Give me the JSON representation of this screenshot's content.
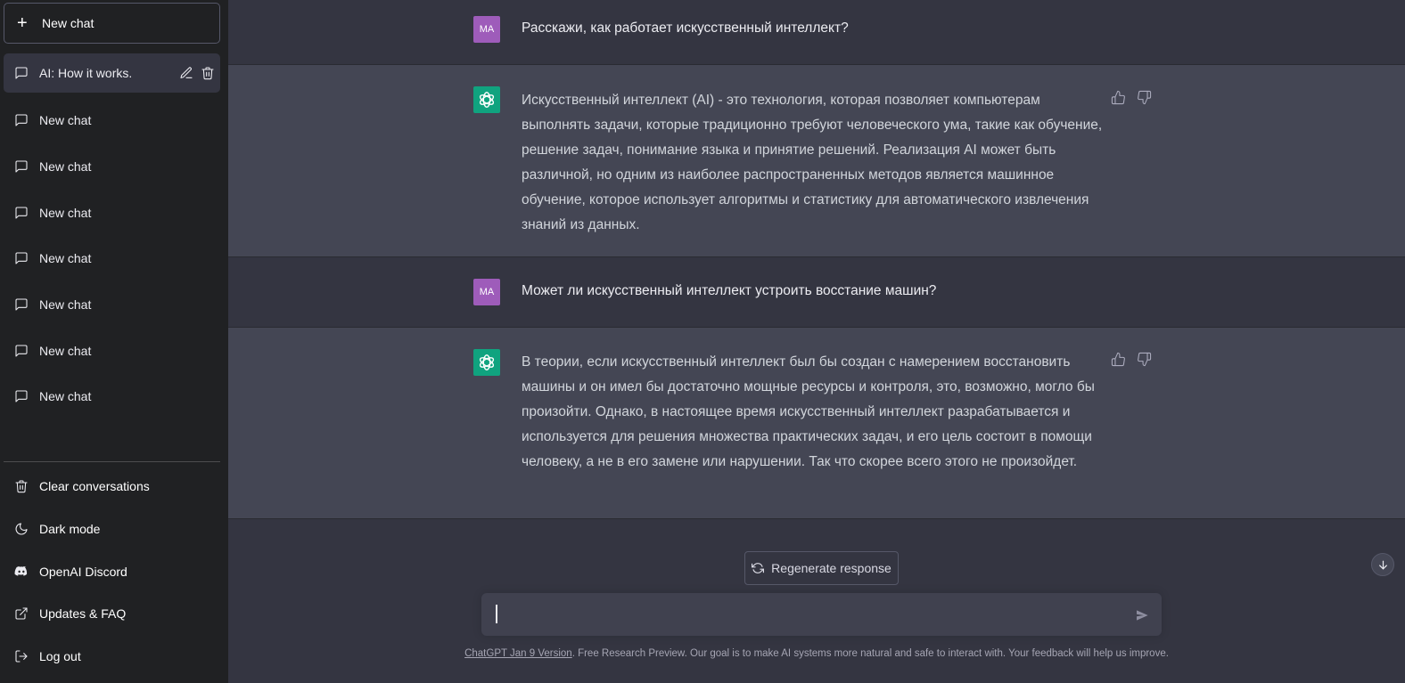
{
  "sidebar": {
    "new_chat_label": "New chat",
    "conversations": [
      {
        "label": "AI: How it works.",
        "active": true
      },
      {
        "label": "New chat"
      },
      {
        "label": "New chat"
      },
      {
        "label": "New chat"
      },
      {
        "label": "New chat"
      },
      {
        "label": "New chat"
      },
      {
        "label": "New chat"
      },
      {
        "label": "New chat"
      }
    ],
    "menu": {
      "clear": "Clear conversations",
      "dark_mode": "Dark mode",
      "discord": "OpenAI Discord",
      "updates": "Updates & FAQ",
      "logout": "Log out"
    }
  },
  "messages": [
    {
      "role": "user",
      "avatar": "MA",
      "text": "Расскажи, как работает искусственный интеллект?"
    },
    {
      "role": "assistant",
      "text": "Искусственный интеллект (AI) - это технология, которая позволяет компьютерам выполнять задачи, которые традиционно требуют человеческого ума, такие как обучение, решение задач, понимание языка и принятие решений. Реализация AI может быть различной, но одним из наиболее распространенных методов является машинное обучение, которое использует алгоритмы и статистику для автоматического извлечения знаний из данных."
    },
    {
      "role": "user",
      "avatar": "MA",
      "text": "Может ли искусственный интеллект устроить восстание машин?"
    },
    {
      "role": "assistant",
      "text": "В теории, если искусственный интеллект был бы создан с намерением восстановить машины и он имел бы достаточно мощные ресурсы и контроля, это, возможно, могло бы произойти. Однако, в настоящее время искусственный интеллект разрабатывается и используется для решения множества практических задач, и его цель состоит в помощи человеку, а не в его замене или нарушении. Так что скорее всего этого не произойдет."
    }
  ],
  "regenerate_label": "Regenerate response",
  "input": {
    "value": ""
  },
  "footer": {
    "version_link": "ChatGPT Jan 9 Version",
    "text": ". Free Research Preview. Our goal is to make AI systems more natural and safe to interact with. Your feedback will help us improve."
  },
  "colors": {
    "sidebar": "#202123",
    "main": "#343541",
    "assistant_row": "#444654",
    "user_avatar": "#9e5cba",
    "bot_avatar": "#10a37f"
  }
}
